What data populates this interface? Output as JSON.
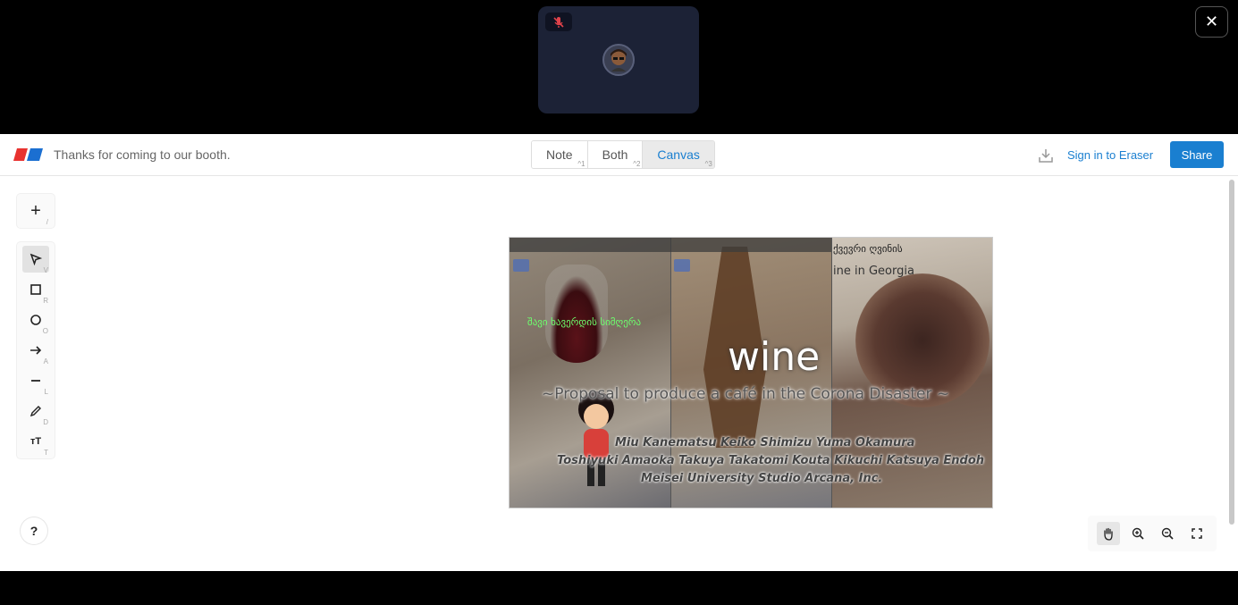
{
  "call": {
    "participant_muted_icon": "mic-off-icon",
    "avatar_icon": "user-avatar",
    "close_icon": "close-icon"
  },
  "header": {
    "title": "Thanks for coming to our booth.",
    "view_modes": [
      {
        "label": "Note",
        "shortcut": "^1",
        "active": false
      },
      {
        "label": "Both",
        "shortcut": "^2",
        "active": false
      },
      {
        "label": "Canvas",
        "shortcut": "^3",
        "active": true
      }
    ],
    "download_icon": "download-icon",
    "sign_in_label": "Sign in to Eraser",
    "share_label": "Share",
    "accent_color": "#1a7fd0"
  },
  "toolbar": {
    "add": {
      "icon": "plus-icon",
      "shortcut": "/"
    },
    "tools": [
      {
        "name": "select",
        "icon": "cursor-icon",
        "shortcut": "V",
        "selected": true
      },
      {
        "name": "rectangle",
        "icon": "square-icon",
        "shortcut": "R",
        "selected": false
      },
      {
        "name": "ellipse",
        "icon": "circle-icon",
        "shortcut": "O",
        "selected": false
      },
      {
        "name": "arrow",
        "icon": "arrow-icon",
        "shortcut": "A",
        "selected": false
      },
      {
        "name": "line",
        "icon": "line-icon",
        "shortcut": "L",
        "selected": false
      },
      {
        "name": "draw",
        "icon": "pencil-icon",
        "shortcut": "D",
        "selected": false
      },
      {
        "name": "text",
        "icon": "text-icon",
        "shortcut": "T",
        "selected": false
      }
    ],
    "help_label": "?"
  },
  "canvas_image": {
    "title": "wine",
    "subtitle": "~Proposal to produce a café in the Corona Disaster ~",
    "authors_line1": "Miu Kanematsu  Keiko Shimizu  Yuma Okamura",
    "authors_line2": "Toshiyuki Amaoka  Takuya Takatomi  Kouta Kikuchi  Katsuya Endoh",
    "affiliations": "Meisei University    Studio Arcana, Inc.",
    "georgian_caption": "შავი ხავერდის სიმღერა",
    "panel3_caption_top": "ქვევრი ღვინის",
    "panel3_caption": "ine in Georgia"
  },
  "view_controls": [
    {
      "name": "pan",
      "icon": "hand-icon",
      "selected": true
    },
    {
      "name": "zoom-in",
      "icon": "zoom-in-icon",
      "selected": false
    },
    {
      "name": "zoom-out",
      "icon": "zoom-out-icon",
      "selected": false
    },
    {
      "name": "fit",
      "icon": "fit-screen-icon",
      "selected": false
    }
  ]
}
